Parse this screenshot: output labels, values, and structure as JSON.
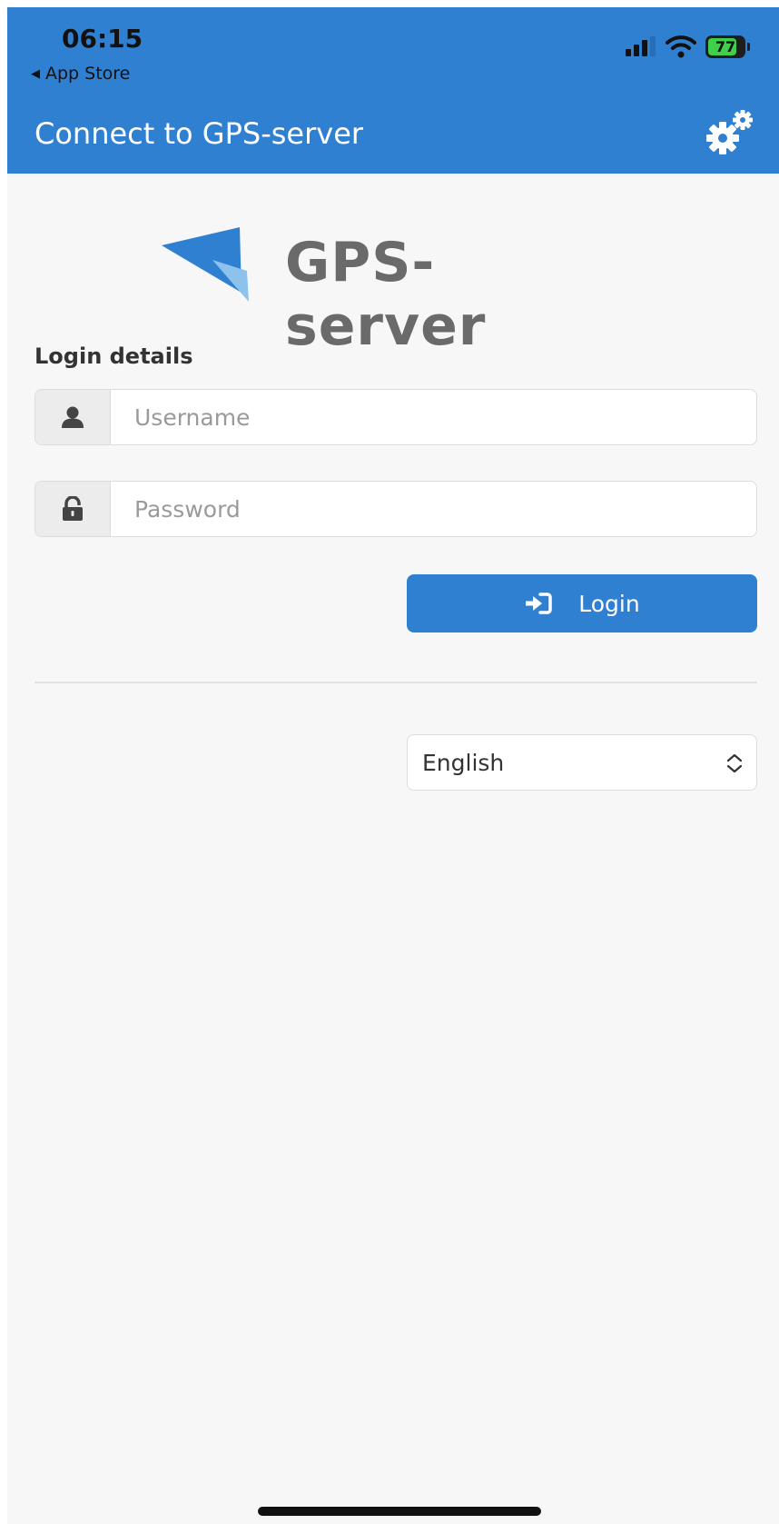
{
  "status_bar": {
    "time": "06:15",
    "back_label": "App Store",
    "battery": "77"
  },
  "nav": {
    "title": "Connect to GPS-server",
    "settings_icon": "gears-icon"
  },
  "logo": {
    "text": "GPS-server"
  },
  "login": {
    "section_title": "Login details",
    "username_placeholder": "Username",
    "password_placeholder": "Password",
    "button_label": "Login"
  },
  "language": {
    "selected": "English"
  },
  "colors": {
    "brand_blue": "#2f80d1",
    "background": "#f7f7f8",
    "logo_gray": "#6a6a6a"
  }
}
